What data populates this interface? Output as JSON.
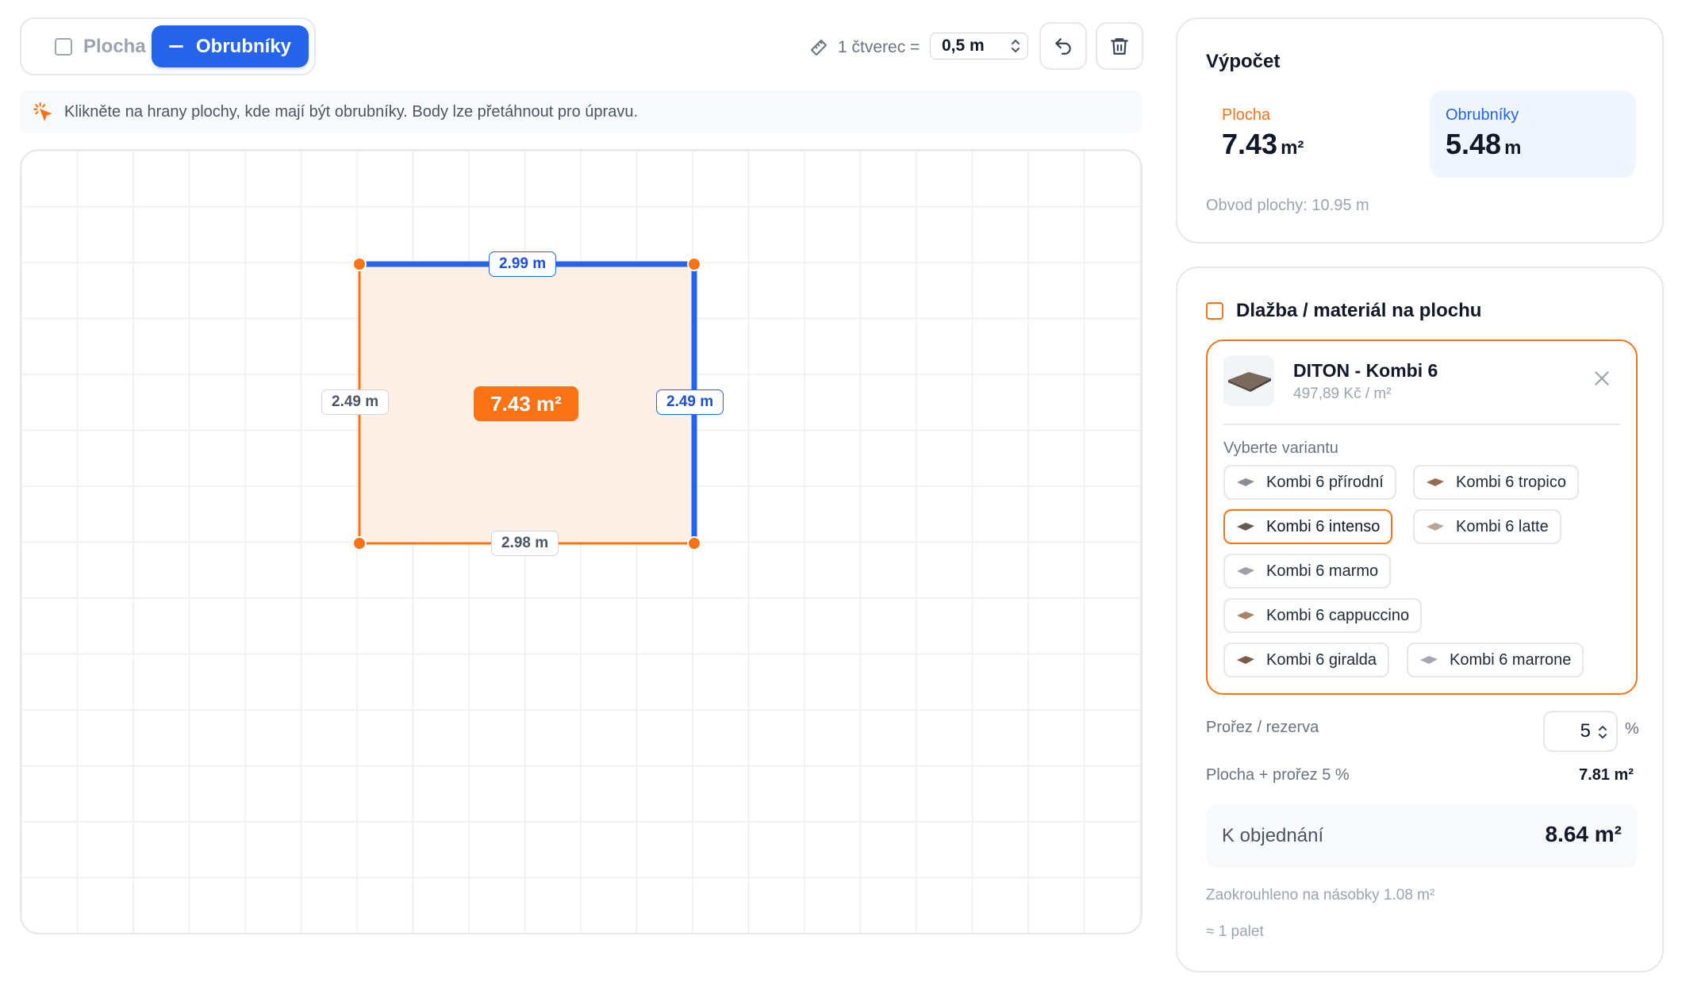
{
  "toolbar": {
    "mode_plocha": "Plocha",
    "mode_obrubniky": "Obrubníky",
    "scale_label": "1 čtverec =",
    "scale_value": "0,5 m",
    "hint": "Klikněte na hrany plochy, kde mají být obrubníky. Body lze přetáhnout pro úpravu."
  },
  "canvas": {
    "edges": {
      "top": "2.99 m",
      "left": "2.49 m",
      "right": "2.49 m",
      "bottom": "2.98 m"
    },
    "area_badge": "7.43 m²"
  },
  "calc": {
    "title": "Výpočet",
    "plocha_label": "Plocha",
    "plocha_value": "7.43",
    "plocha_unit": "m²",
    "obrubniky_label": "Obrubníky",
    "obrubniky_value": "5.48",
    "obrubniky_unit": "m",
    "obvod": "Obvod plochy: 10.95 m"
  },
  "material": {
    "title": "Dlažba / materiál na plochu",
    "product_name": "DITON - Kombi 6",
    "product_price": "497,89 Kč / m²",
    "variant_title": "Vyberte variantu",
    "variants": [
      {
        "label": "Kombi 6 přírodní",
        "color": "#8a8f96"
      },
      {
        "label": "Kombi 6 tropico",
        "color": "#9a6a52"
      },
      {
        "label": "Kombi 6 intenso",
        "color": "#6b5a4e"
      },
      {
        "label": "Kombi 6 latte",
        "color": "#b7a89a"
      },
      {
        "label": "Kombi 6 marmo",
        "color": "#9ca1a8"
      },
      {
        "label": "Kombi 6 cappuccino",
        "color": "#a98466"
      },
      {
        "label": "Kombi 6 giralda",
        "color": "#7c5a48"
      },
      {
        "label": "Kombi 6 marrone",
        "color": "#a3a6ab"
      }
    ],
    "selected_variant": "Kombi 6 intenso",
    "prorez_label": "Prořez / rezerva",
    "prorez_value": "5",
    "prorez_unit": "%",
    "plocha_prorez_label": "Plocha + prořez 5 %",
    "plocha_prorez_value": "7.81 m²",
    "order_label": "K objednání",
    "order_value": "8.64 m²",
    "rounded_note": "Zaokrouhleno na násobky 1.08 m²",
    "pallets": "≈ 1 palet"
  },
  "colors": {
    "accent_blue": "#2563eb",
    "accent_orange": "#f97316"
  }
}
